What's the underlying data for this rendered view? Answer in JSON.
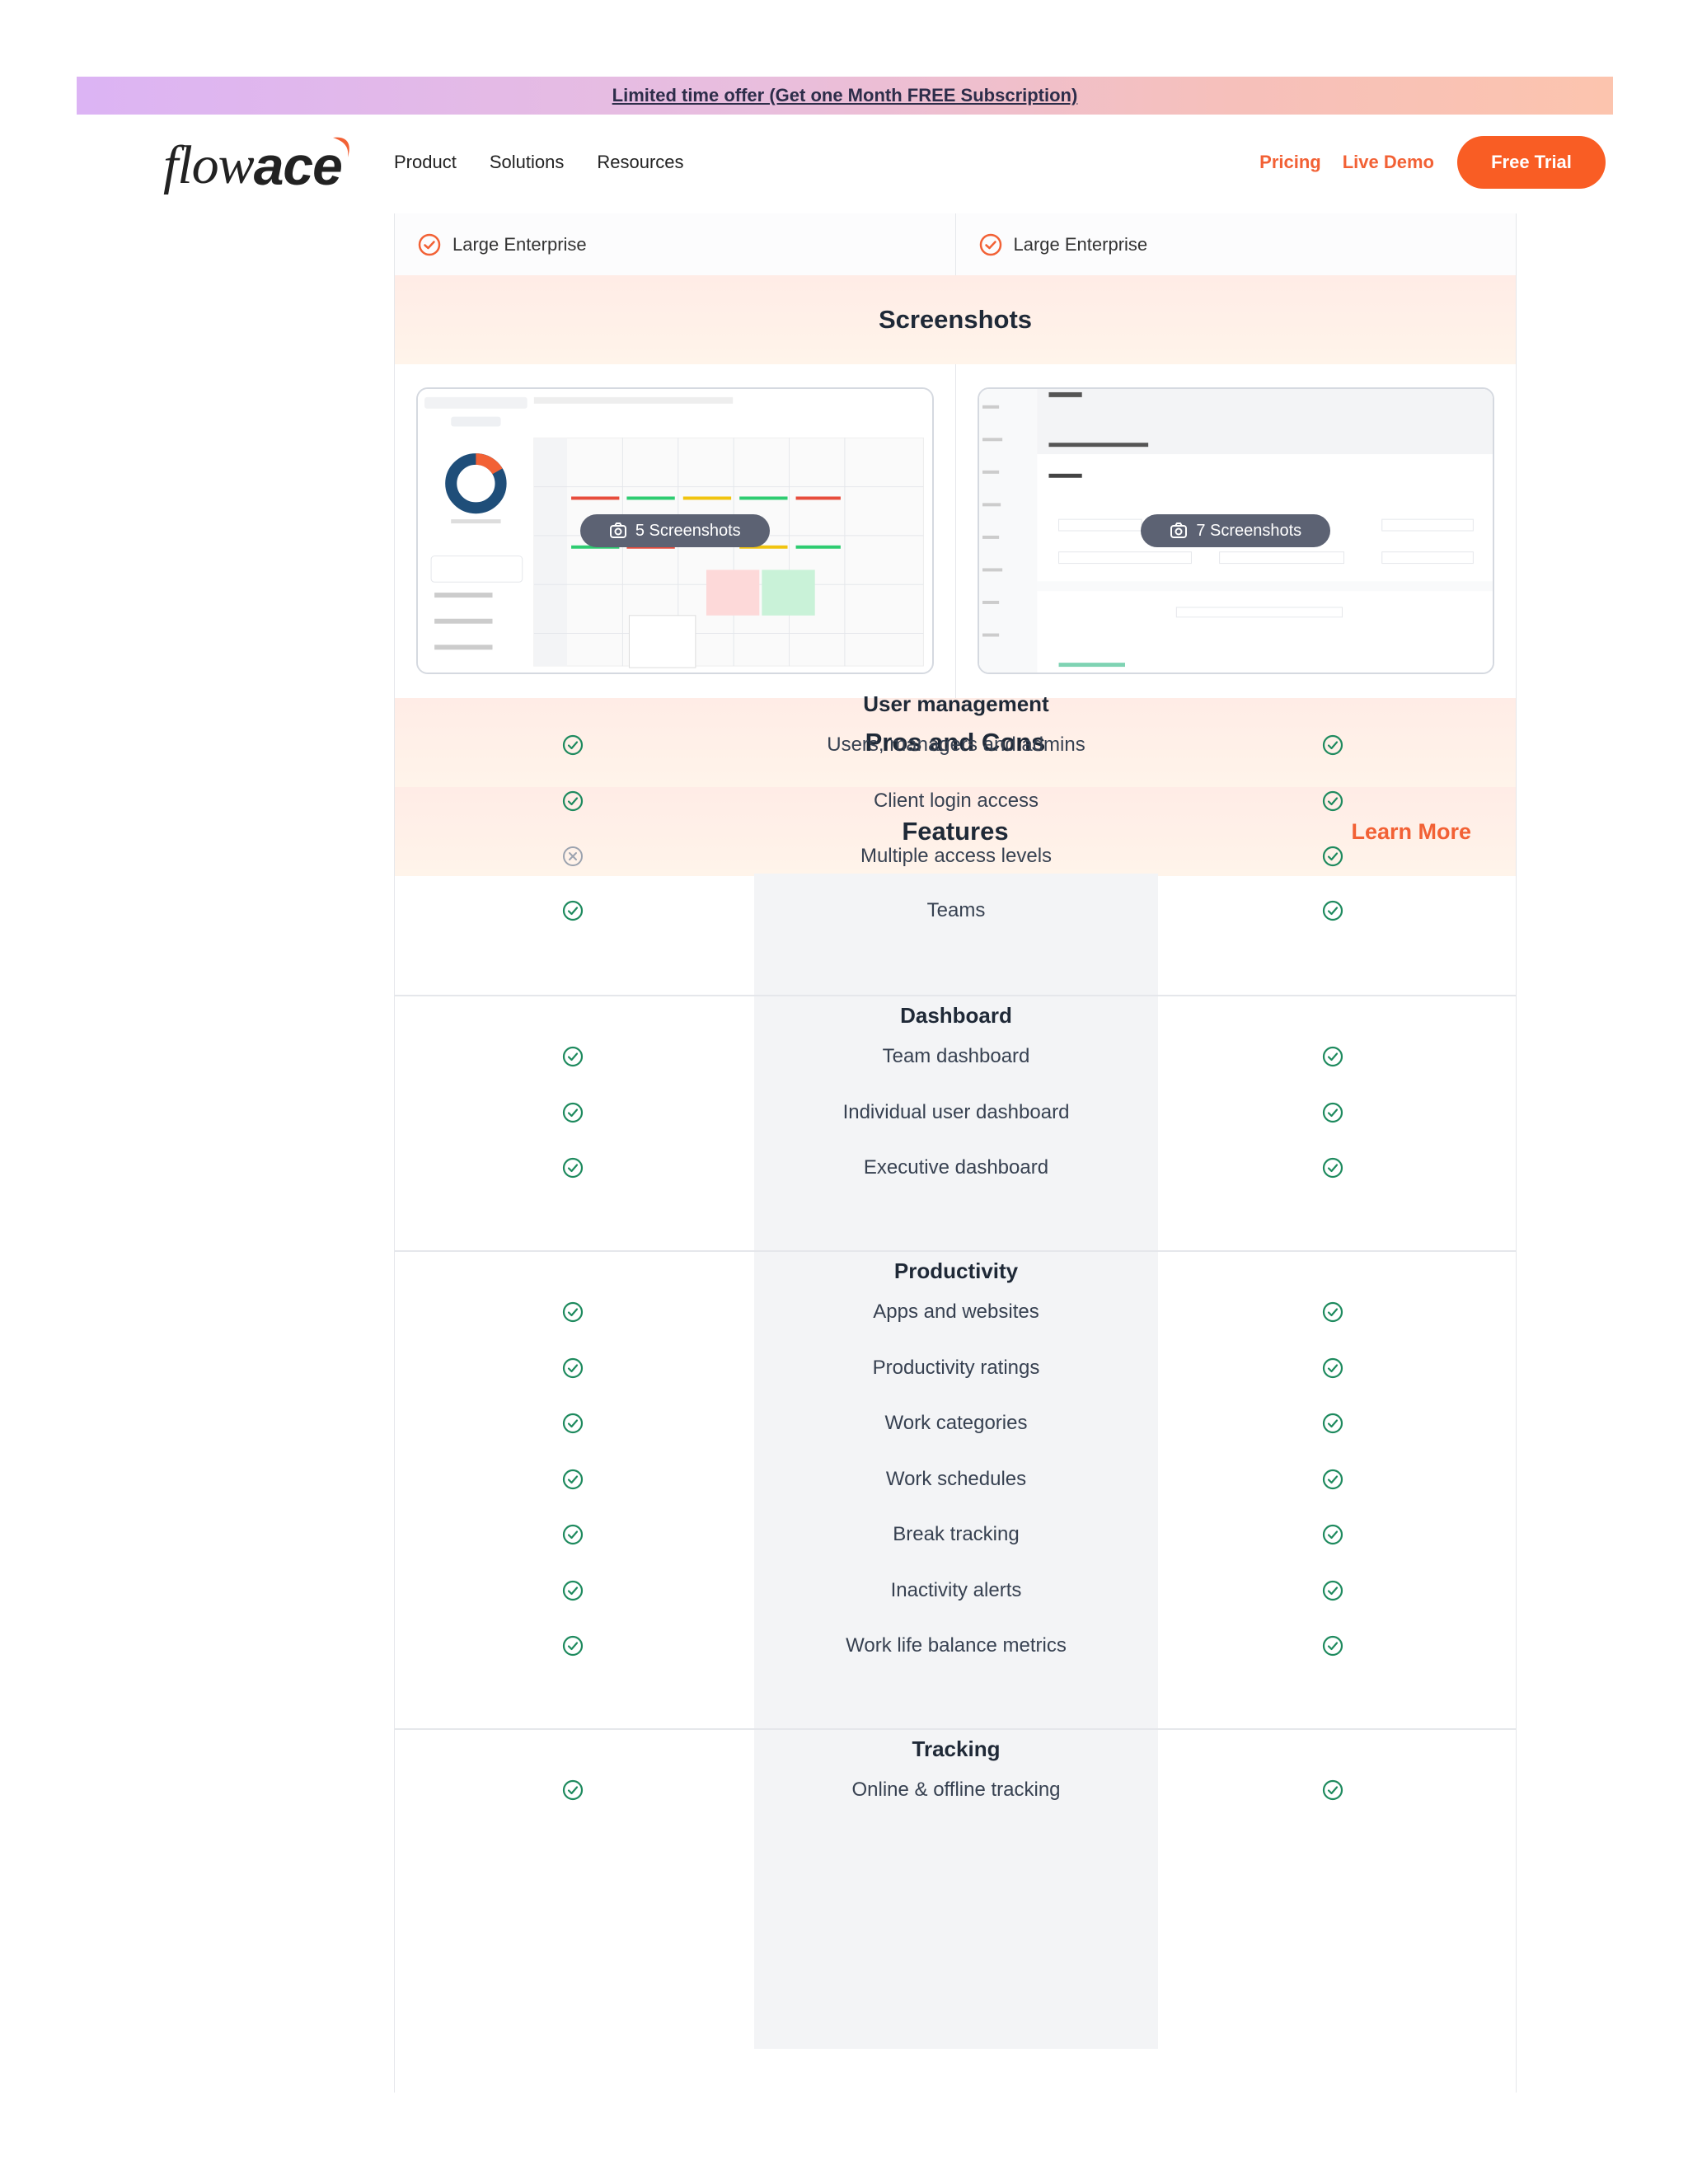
{
  "promo": {
    "text": "Limited time offer (Get one Month FREE Subscription)"
  },
  "nav": {
    "logo_light": "flow",
    "logo_bold": "ace",
    "menu": [
      "Product",
      "Solutions",
      "Resources"
    ],
    "pricing": "Pricing",
    "live_demo": "Live Demo",
    "free_trial": "Free Trial"
  },
  "enterprise": {
    "left": "Large Enterprise",
    "right": "Large Enterprise"
  },
  "screenshots": {
    "title": "Screenshots",
    "left_count": "5 Screenshots",
    "right_count": "7 Screenshots"
  },
  "pros_cons": {
    "title": "Pros and Cons"
  },
  "features": {
    "title": "Features",
    "learn_more": "Learn More",
    "sections": [
      {
        "title": "User management",
        "rows": [
          {
            "label": "Users, managers and admins",
            "left": true,
            "right": true
          },
          {
            "label": "Client login access",
            "left": true,
            "right": true
          },
          {
            "label": "Multiple access levels",
            "left": false,
            "right": true
          },
          {
            "label": "Teams",
            "left": true,
            "right": true
          }
        ]
      },
      {
        "title": "Dashboard",
        "rows": [
          {
            "label": "Team dashboard",
            "left": true,
            "right": true
          },
          {
            "label": "Individual user dashboard",
            "left": true,
            "right": true
          },
          {
            "label": "Executive dashboard",
            "left": true,
            "right": true
          }
        ]
      },
      {
        "title": "Productivity",
        "rows": [
          {
            "label": "Apps and websites",
            "left": true,
            "right": true
          },
          {
            "label": "Productivity ratings",
            "left": true,
            "right": true
          },
          {
            "label": "Work categories",
            "left": true,
            "right": true
          },
          {
            "label": "Work schedules",
            "left": true,
            "right": true
          },
          {
            "label": "Break tracking",
            "left": true,
            "right": true
          },
          {
            "label": "Inactivity alerts",
            "left": true,
            "right": true
          },
          {
            "label": "Work life balance metrics",
            "left": true,
            "right": true
          }
        ]
      },
      {
        "title": "Tracking",
        "rows": [
          {
            "label": "Online & offline tracking",
            "left": true,
            "right": true
          }
        ]
      }
    ]
  },
  "colors": {
    "accent": "#f95d24",
    "check": "#1e8a5e",
    "cross": "#9ca3af"
  }
}
